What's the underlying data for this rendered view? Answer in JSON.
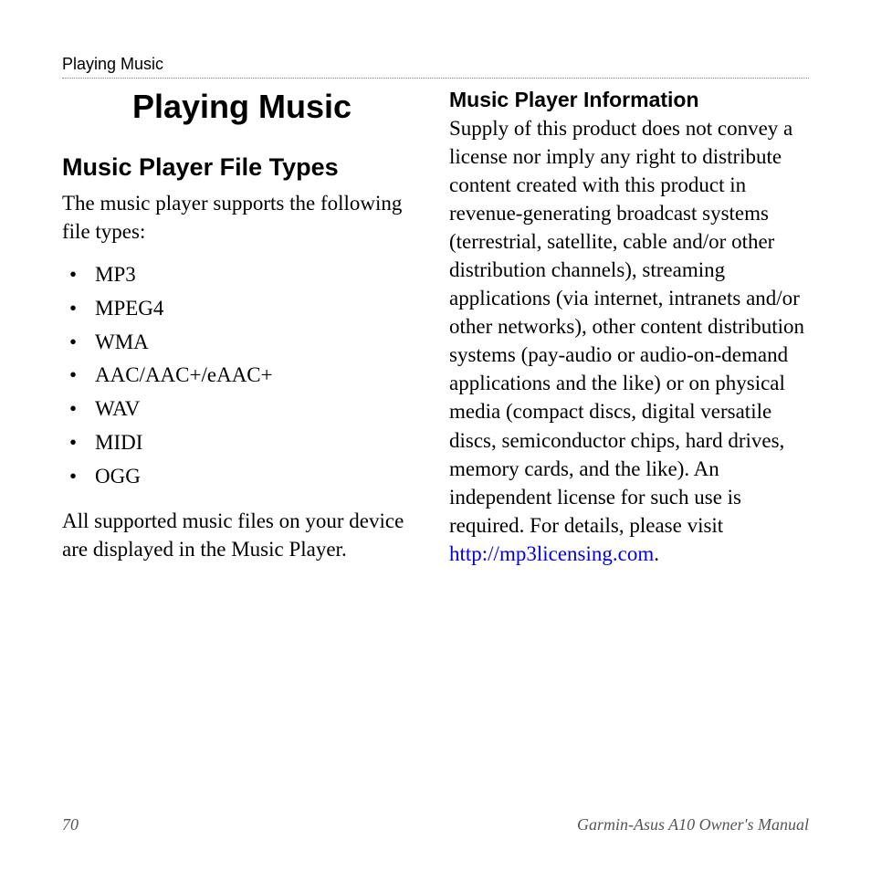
{
  "header": {
    "section": "Playing Music"
  },
  "left": {
    "title": "Playing Music",
    "subtitle": "Music Player File Types",
    "intro": "The music player supports the following file types:",
    "file_types": [
      "MP3",
      "MPEG4",
      "WMA",
      "AAC/AAC+/eAAC+",
      "WAV",
      "MIDI",
      "OGG"
    ],
    "outro": "All supported music files on your device are displayed in the Music Player."
  },
  "right": {
    "heading": "Music Player Information",
    "body": "Supply of this product does not convey a license nor imply any right to distribute content created with this product in revenue-generating broadcast systems (terrestrial, satellite, cable and/or other distribution channels), streaming applications (via internet, intranets and/or other networks), other content distribution systems (pay-audio or audio-on-demand applications and the like) or on physical media (compact discs, digital versatile discs, semiconductor chips, hard drives, memory cards, and the like). An independent license for such use is required. For details, please visit ",
    "link_text": "http://mp3licensing.com",
    "period": "."
  },
  "footer": {
    "page": "70",
    "manual": "Garmin-Asus A10 Owner's Manual"
  }
}
